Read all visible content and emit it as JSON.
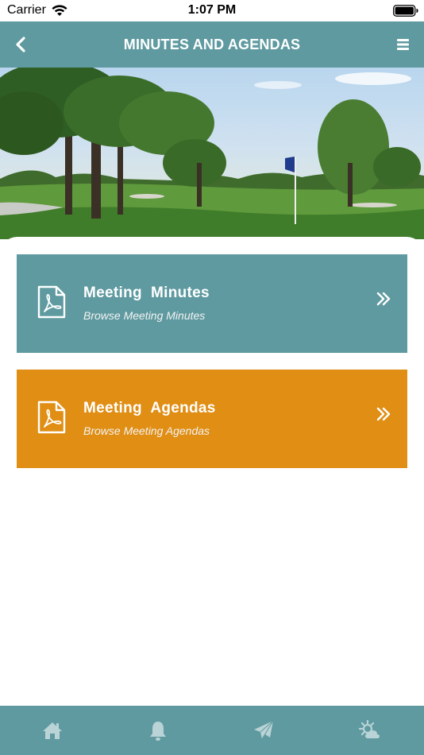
{
  "status_bar": {
    "carrier": "Carrier",
    "time": "1:07 PM"
  },
  "nav": {
    "title": "MINUTES AND AGENDAS",
    "back_icon": "chevron-left-icon",
    "menu_icon": "hamburger-menu-icon"
  },
  "hero": {
    "subject": "golf course with trees and flag"
  },
  "cards": [
    {
      "title": "Meeting  Minutes",
      "subtitle": "Browse Meeting Minutes",
      "icon": "pdf-document-icon",
      "color": "#5e9aa0"
    },
    {
      "title": "Meeting  Agendas",
      "subtitle": "Browse Meeting Agendas",
      "icon": "pdf-document-icon",
      "color": "#e08e14"
    }
  ],
  "tabs": [
    {
      "icon": "home-icon"
    },
    {
      "icon": "bell-icon"
    },
    {
      "icon": "paper-plane-icon"
    },
    {
      "icon": "weather-sun-cloud-icon"
    }
  ],
  "colors": {
    "primary": "#5e9aa0",
    "accent": "#e08e14",
    "background": "#ffffff"
  }
}
